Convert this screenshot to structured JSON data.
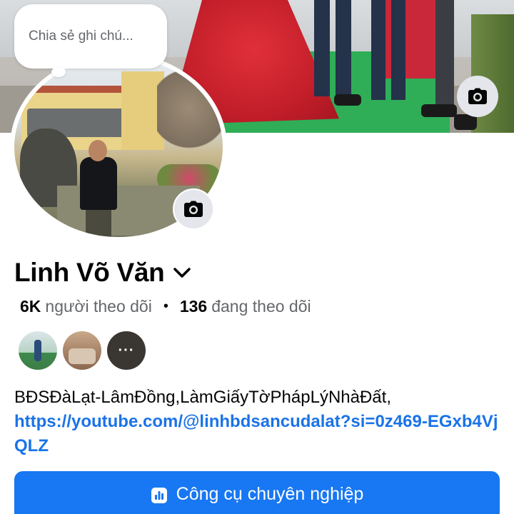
{
  "note": {
    "placeholder": "Chia sẻ ghi chú..."
  },
  "profile": {
    "name": "Linh Võ Văn",
    "followers_count": "6K",
    "followers_label": "người theo dõi",
    "separator": "•",
    "following_count": "136",
    "following_label": "đang theo dõi"
  },
  "friends": {
    "more_label": "···"
  },
  "bio": {
    "text": "BĐSĐàLạt-LâmĐồng,LàmGiấyTờPhápLýNhàĐất,",
    "link": "https://youtube.com/@linhbdsancudalat?si=0z469-EGxb4VjQLZ"
  },
  "actions": {
    "pro_tools_label": "Công cụ chuyên nghiệp"
  },
  "icons": {
    "cover_camera": "camera-icon",
    "avatar_camera": "camera-icon",
    "name_dropdown": "chevron-down-icon",
    "pro_tools": "bar-chart-icon"
  },
  "colors": {
    "accent": "#1877f2",
    "link": "#1a73e8",
    "secondary_text": "#65676b"
  }
}
